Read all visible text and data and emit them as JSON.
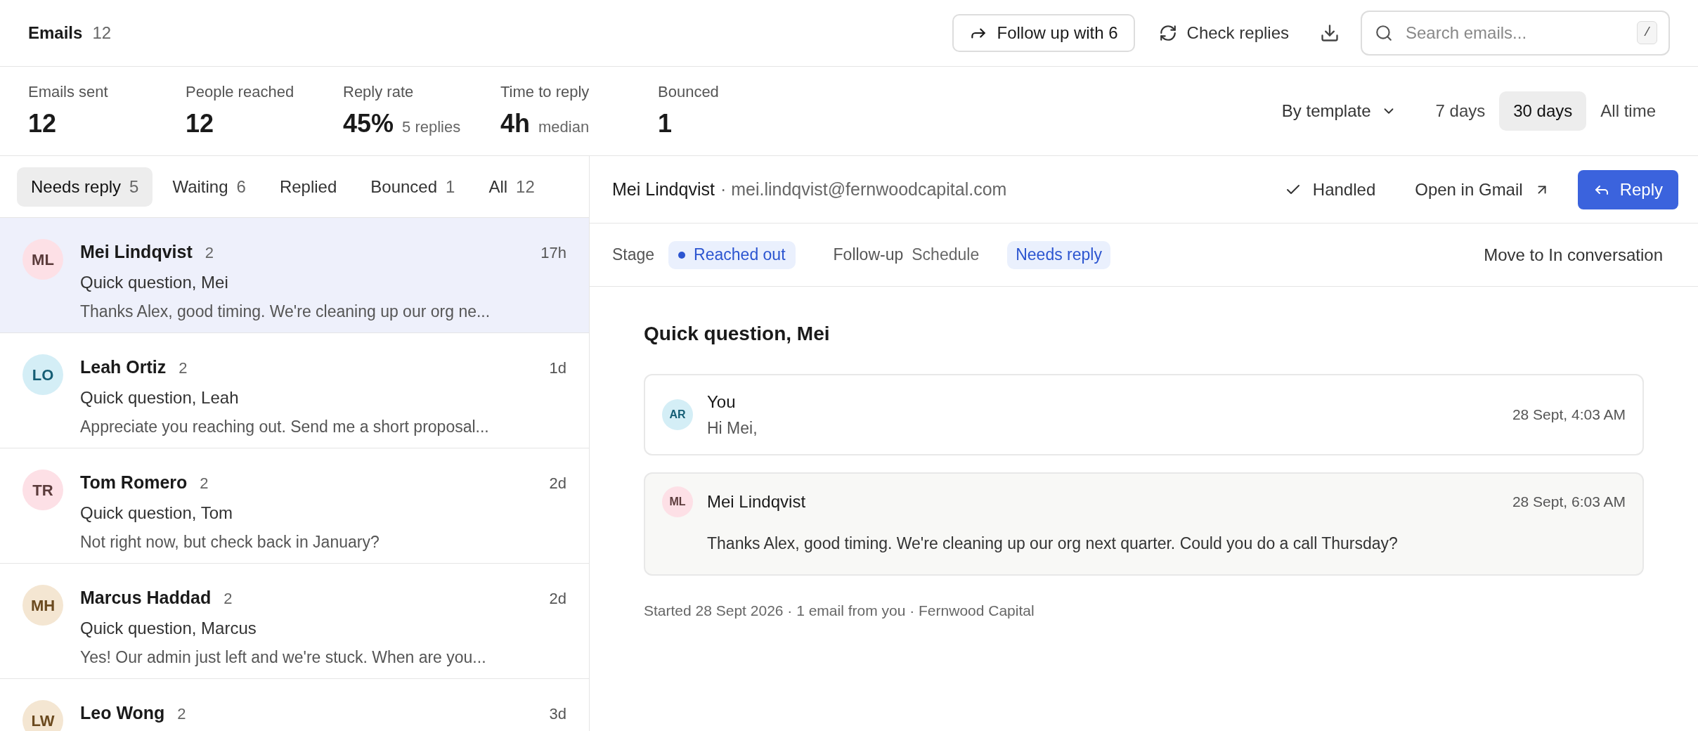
{
  "header": {
    "title": "Emails",
    "count": "12",
    "follow_up": "Follow up with 6",
    "check_replies": "Check replies",
    "search": {
      "placeholder": "Search emails...",
      "shortcut": "/"
    }
  },
  "stats": [
    {
      "label": "Emails sent",
      "value": "12"
    },
    {
      "label": "People reached",
      "value": "12"
    },
    {
      "label": "Reply rate",
      "value": "45%",
      "note": "5 replies"
    },
    {
      "label": "Time to reply",
      "value": "4h",
      "note": "median"
    },
    {
      "label": "Bounced",
      "value": "1"
    }
  ],
  "group_by": "By template",
  "ranges": [
    {
      "label": "7 days",
      "selected": false
    },
    {
      "label": "30 days",
      "selected": true
    },
    {
      "label": "All time",
      "selected": false
    }
  ],
  "tabs": [
    {
      "label": "Needs reply",
      "count": "5",
      "selected": true
    },
    {
      "label": "Waiting",
      "count": "6",
      "selected": false
    },
    {
      "label": "Replied",
      "selected": false
    },
    {
      "label": "Bounced",
      "count": "1",
      "selected": false
    },
    {
      "label": "All",
      "count": "12",
      "selected": false
    }
  ],
  "emails": [
    {
      "initials": "ML",
      "color": "#fde0e6",
      "name": "Mei Lindqvist",
      "count": "2",
      "time": "17h",
      "subject": "Quick question, Mei",
      "preview": "Thanks Alex, good timing. We're cleaning up our org ne...",
      "selected": true
    },
    {
      "initials": "LO",
      "color": "#d4eef6",
      "name": "Leah Ortiz",
      "count": "2",
      "time": "1d",
      "subject": "Quick question, Leah",
      "preview": "Appreciate you reaching out. Send me a short proposal...",
      "selected": false
    },
    {
      "initials": "TR",
      "color": "#fde0e6",
      "name": "Tom Romero",
      "count": "2",
      "time": "2d",
      "subject": "Quick question, Tom",
      "preview": "Not right now, but check back in January?",
      "selected": false
    },
    {
      "initials": "MH",
      "color": "#f4e6d2",
      "name": "Marcus Haddad",
      "count": "2",
      "time": "2d",
      "subject": "Quick question, Marcus",
      "preview": "Yes! Our admin just left and we're stuck. When are you...",
      "selected": false
    },
    {
      "initials": "LW",
      "color": "#f4e6d2",
      "name": "Leo Wong",
      "count": "2",
      "time": "3d",
      "selected": false
    }
  ],
  "detail": {
    "name": "Mei Lindqvist",
    "email": "· mei.lindqvist@fernwoodcapital.com",
    "handled": "Handled",
    "open": "Open in Gmail",
    "reply": "Reply",
    "stage_label": "Stage",
    "stage": "Reached out",
    "followup_label": "Follow-up",
    "followup_value": "Schedule",
    "status": "Needs reply",
    "move": "Move to In conversation",
    "subject": "Quick question, Mei",
    "messages": [
      {
        "kind": "sent",
        "initials": "AR",
        "color": "#d4eef6",
        "sender": "You",
        "time": "28 Sept, 4:03 AM",
        "body": "Hi Mei,"
      },
      {
        "kind": "received",
        "initials": "ML",
        "color": "#fde0e6",
        "sender": "Mei Lindqvist",
        "time": "28 Sept, 6:03 AM",
        "body": "Thanks Alex, good timing. We're cleaning up our org next quarter. Could you do a call Thursday?"
      }
    ],
    "footer": "Started 28 Sept 2026 · 1 email from you · Fernwood Capital"
  }
}
